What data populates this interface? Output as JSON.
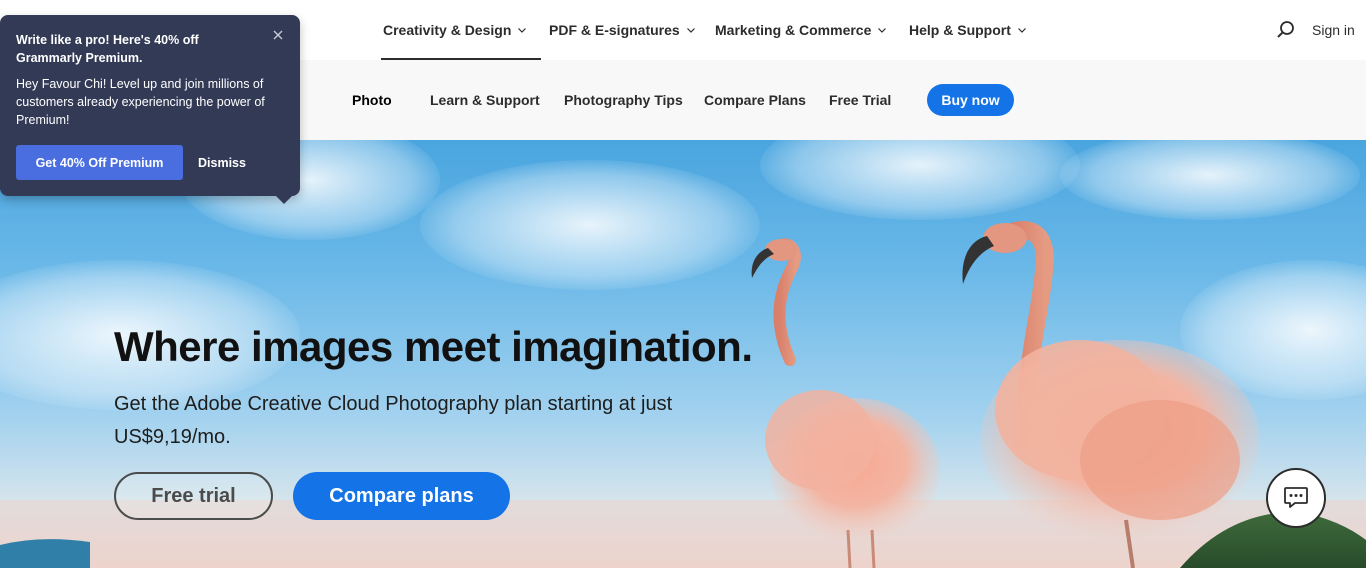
{
  "global_nav": {
    "items": [
      {
        "label": "Creativity & Design"
      },
      {
        "label": "PDF & E-signatures"
      },
      {
        "label": "Marketing & Commerce"
      },
      {
        "label": "Help & Support"
      }
    ],
    "sign_in": "Sign in"
  },
  "sub_nav": {
    "product": "Photo",
    "items": [
      {
        "label": "Learn & Support"
      },
      {
        "label": "Photography Tips"
      },
      {
        "label": "Compare Plans"
      },
      {
        "label": "Free Trial"
      }
    ],
    "buy_now": "Buy now"
  },
  "hero": {
    "title": "Where images meet imagination.",
    "subtitle": "Get the Adobe Creative Cloud Photography plan starting at just US$9,19/mo.",
    "free_trial": "Free trial",
    "compare_plans": "Compare plans"
  },
  "grammarly_popup": {
    "title": "Write like a pro! Here's 40% off Grammarly Premium.",
    "body": "Hey Favour Chi! Level up and join millions of customers already experiencing the power of Premium!",
    "cta": "Get 40% Off Premium",
    "dismiss": "Dismiss"
  },
  "colors": {
    "accent_blue": "#1473e6",
    "popup_bg": "#333a56",
    "popup_cta": "#4a6ee0"
  },
  "icons": {
    "search": "search-icon",
    "chevron": "chevron-down-icon",
    "chat": "chat-icon",
    "close": "close-icon"
  }
}
